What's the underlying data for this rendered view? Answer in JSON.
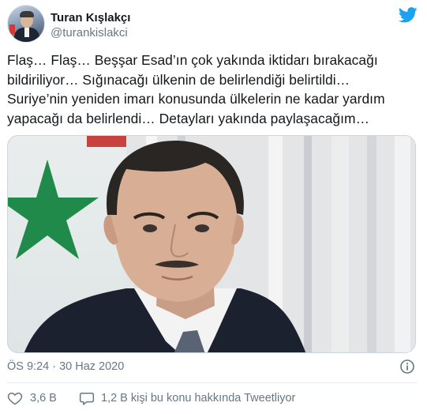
{
  "author": {
    "display_name": "Turan Kışlakçı",
    "handle": "@turankislakci",
    "avatar_icon": "profile-photo",
    "logo_icon": "twitter-bird-icon",
    "brand_color": "#1da1f2"
  },
  "tweet": {
    "text": "Flaş… Flaş… Beşşar Esad’ın çok yakında iktidarı bırakacağı\nbildiriliyor… Sığınacağı ülkenin de belirlendiği belirtildi…\nSuriye’nin yeniden imarı konusunda ülkelerin ne kadar yardım\nyapacağı da belirlendi… Detayları yakında paylaşacağım…",
    "media_icon": "attached-photo"
  },
  "meta": {
    "timestamp": "ÖS 9:24 · 30 Haz 2020",
    "info_icon": "info-icon"
  },
  "actions": {
    "like_icon": "heart-icon",
    "like_count": "3,6 B",
    "reply_icon": "speech-bubble-icon",
    "reply_text": "1,2 B kişi bu konu hakkında Tweetliyor"
  },
  "colors": {
    "text_primary": "#14171a",
    "text_secondary": "#657786",
    "divider": "#e6ecf0",
    "twitter_blue": "#1da1f2"
  }
}
